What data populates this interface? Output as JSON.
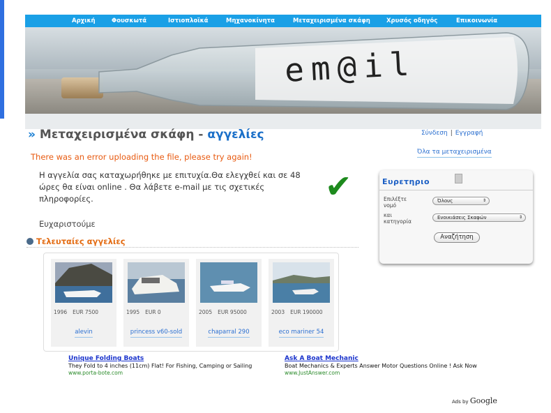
{
  "nav": {
    "items": [
      "Αρχική",
      "Φουσκωτά",
      "Ιστιοπλοϊκά",
      "Μηχανοκίνητα",
      "Μεταχειρισμένα σκάφη",
      "Χρυσός οδηγός",
      "Επικοινωνία"
    ]
  },
  "banner": {
    "text": "em@il"
  },
  "header": {
    "title_main": "Μεταχειρισμένα σκάφη -",
    "title_accent": "αγγελίες",
    "login": "Σύνδεση",
    "register": "Εγγραφή",
    "all_used": "Όλα τα μεταχειρισμένα"
  },
  "messages": {
    "error": "There was an error uploading the file, please try again!",
    "success": "Η αγγελία σας καταχωρήθηκε με επιτυχία.Θα ελεγχθεί και σε 48 ώρες θα είναι online . Θα λάβετε e-mail με τις σχετικές πληροφορίες.",
    "thanks": "Ευχαριστούμε"
  },
  "latest": {
    "heading": "Τελευταίες αγγελίες",
    "items": [
      {
        "year": "1996",
        "price": "EUR  7500",
        "name": "alevin"
      },
      {
        "year": "1995",
        "price": "EUR  0",
        "name": "princess  v60-sold"
      },
      {
        "year": "2005",
        "price": "EUR  95000",
        "name": "chaparral  290"
      },
      {
        "year": "2003",
        "price": "EUR  190000",
        "name": "eco  mariner  54"
      }
    ]
  },
  "index": {
    "title": "Ευρετηριο",
    "region_label": "Επιλέξτε νομό",
    "region_value": "Όλους",
    "category_label": "και κατηγορία",
    "category_value": "Ενοικιάσεις Σκαφών",
    "search_button": "Αναζήτηση"
  },
  "ads": [
    {
      "title": "Unique Folding Boats",
      "desc": "They Fold to 4 inches (11cm) Flat! For Fishing, Camping or Sailing",
      "url": "www.porta-bote.com"
    },
    {
      "title": "Ask A Boat Mechanic",
      "desc": "Boat Mechanics & Experts Answer Motor Questions Online ! Ask Now",
      "url": "www.JustAnswer.com"
    }
  ],
  "ads_by": {
    "prefix": "Ads by",
    "brand": "Google"
  },
  "colors": {
    "nav": "#1aa0e6",
    "error": "#e85a10",
    "link": "#2a6fcf",
    "heading_orange": "#e36b12",
    "check": "#1d8a1d"
  }
}
